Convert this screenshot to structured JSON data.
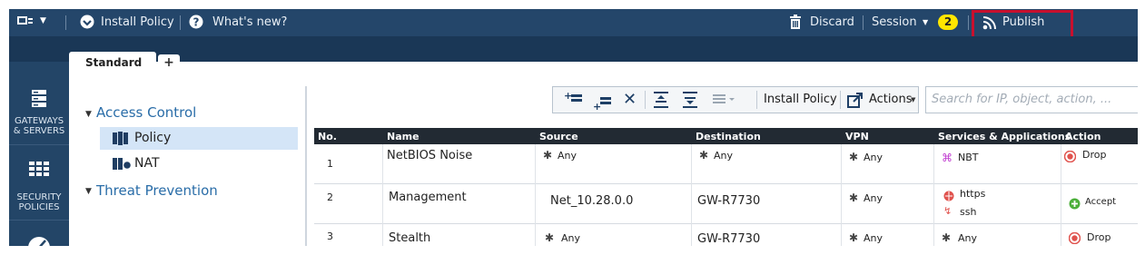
{
  "topbar": {
    "install_policy": "Install Policy",
    "whats_new": "What's new?",
    "discard": "Discard",
    "session": "Session",
    "session_count": "2",
    "publish": "Publish",
    "highlight_color": "#c8102e"
  },
  "tabs": {
    "standard": "Standard",
    "add": "+"
  },
  "rail": {
    "gateways": [
      "GATEWAYS",
      "& SERVERS"
    ],
    "security": [
      "SECURITY",
      "POLICIES"
    ]
  },
  "tree": {
    "access_control": "Access Control",
    "policy": "Policy",
    "nat": "NAT",
    "threat_prevention": "Threat Prevention"
  },
  "toolbar": {
    "install_policy": "Install Policy",
    "actions": "Actions",
    "search_placeholder": "Search for IP, object, action, ..."
  },
  "table": {
    "columns": [
      "No.",
      "Name",
      "Source",
      "Destination",
      "VPN",
      "Services & Applications",
      "Action"
    ],
    "rows": [
      {
        "no": "1",
        "name": "NetBIOS Noise",
        "source": "Any",
        "destination": "Any",
        "vpn": "Any",
        "services": [
          "NBT"
        ],
        "action": "Drop"
      },
      {
        "no": "2",
        "name": "Management",
        "source": "Net_10.28.0.0",
        "destination": "GW-R7730",
        "vpn": "Any",
        "services": [
          "https",
          "ssh"
        ],
        "action": "Accept"
      },
      {
        "no": "3",
        "name": "Stealth",
        "source": "Any",
        "destination": "GW-R7730",
        "vpn": "Any",
        "services": [
          "Any"
        ],
        "action": "Drop"
      }
    ]
  },
  "colors": {
    "topbar": "#24466a",
    "link_blue": "#2a6da8",
    "badge": "#ffe600",
    "drop": "#e0524d",
    "accept": "#4caf3a"
  }
}
